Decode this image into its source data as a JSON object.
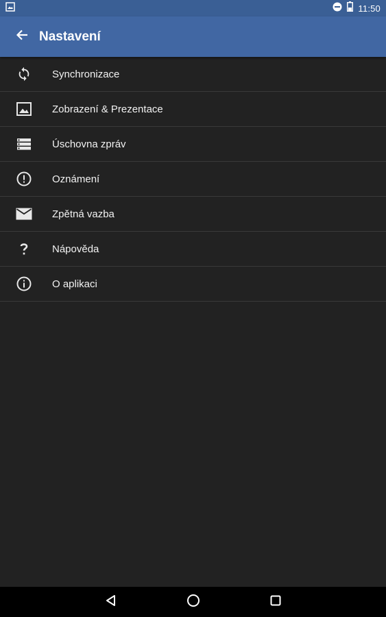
{
  "status_bar": {
    "time": "11:50",
    "icons": [
      "image-notification-icon",
      "do-not-disturb-icon",
      "battery-icon"
    ]
  },
  "app_bar": {
    "title": "Nastavení",
    "back_icon": "arrow-back-icon"
  },
  "settings": {
    "items": [
      {
        "label": "Synchronizace",
        "icon": "sync-icon"
      },
      {
        "label": "Zobrazení & Prezentace",
        "icon": "image-icon"
      },
      {
        "label": "Úschovna zpráv",
        "icon": "storage-icon"
      },
      {
        "label": "Oznámení",
        "icon": "info-icon"
      },
      {
        "label": "Zpětná vazba",
        "icon": "mail-icon"
      },
      {
        "label": "Nápověda",
        "icon": "help-icon"
      },
      {
        "label": "O aplikaci",
        "icon": "info-icon"
      }
    ]
  },
  "nav_bar": {
    "icons": [
      "back-triangle-icon",
      "home-circle-icon",
      "recents-square-icon"
    ]
  },
  "colors": {
    "status_bar": "#3a5f95",
    "app_bar": "#4167a3",
    "background": "#222222",
    "divider": "#3a3a3a",
    "nav_bar": "#000000"
  }
}
